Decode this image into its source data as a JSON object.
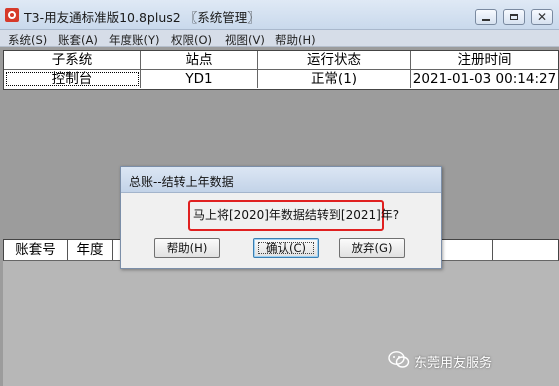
{
  "window": {
    "title": "T3-用友通标准版10.8plus2 〖系统管理〗",
    "minimize": "",
    "maximize": "",
    "close": "✕"
  },
  "menu": [
    {
      "label": "系统(S)"
    },
    {
      "label": "账套(A)"
    },
    {
      "label": "年度账(Y)"
    },
    {
      "label": "权限(O)"
    },
    {
      "label": "视图(V)"
    },
    {
      "label": "帮助(H)"
    }
  ],
  "grid": {
    "columns": [
      "子系统",
      "站点",
      "运行状态",
      "注册时间"
    ],
    "rows": [
      [
        "控制台",
        "YD1",
        "正常(1)",
        "2021-01-03 00:14:27"
      ]
    ]
  },
  "lower_grid": {
    "columns": [
      "账套号",
      "年度",
      ""
    ]
  },
  "dialog": {
    "title": "总账--结转上年数据",
    "message": "马上将[2020]年数据结转到[2021]年?",
    "buttons": {
      "help": "帮助(H)",
      "ok": "确认(C)",
      "giveup": "放弃(G)"
    },
    "highlight_color": "#e02020"
  },
  "watermark": {
    "text": "东莞用友服务",
    "icon": "wechat-icon"
  }
}
